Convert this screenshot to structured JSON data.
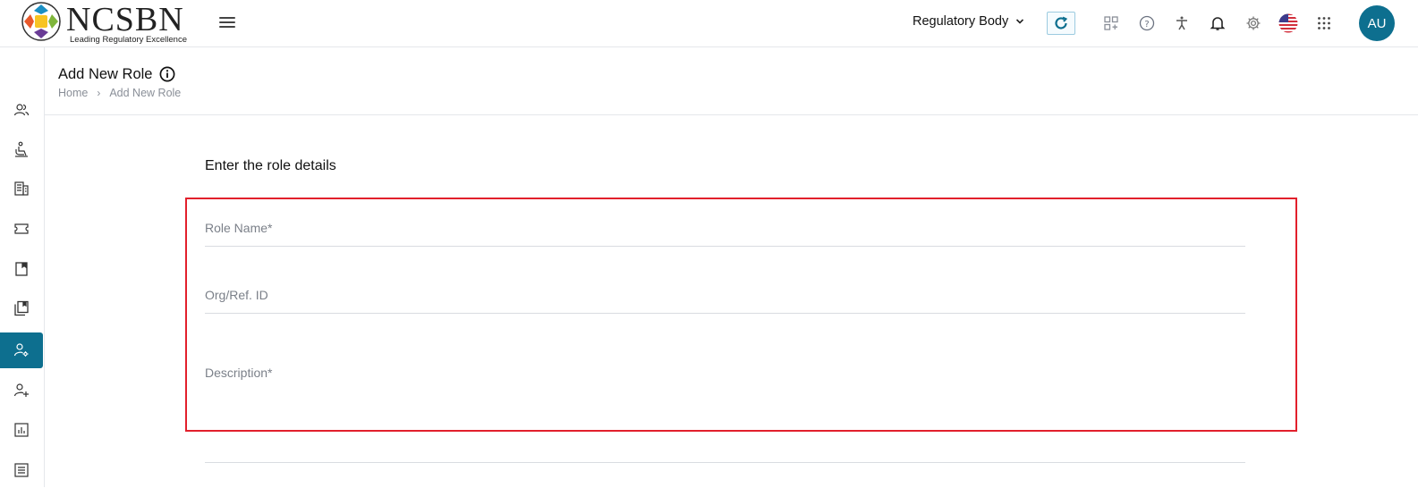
{
  "header": {
    "logo_name": "NCSBN",
    "logo_tagline": "Leading Regulatory Excellence",
    "org_selector": "Regulatory Body",
    "avatar_initials": "AU",
    "accent_color": "#0d6f8f"
  },
  "sidebar": {
    "items": [
      {
        "icon": "users-icon",
        "active": false
      },
      {
        "icon": "candidate-seat-icon",
        "active": false
      },
      {
        "icon": "building-icon",
        "active": false
      },
      {
        "icon": "ticket-icon",
        "active": false
      },
      {
        "icon": "bookmark-icon",
        "active": false
      },
      {
        "icon": "library-icon",
        "active": false
      },
      {
        "icon": "user-settings-icon",
        "active": true
      },
      {
        "icon": "add-user-icon",
        "active": false
      },
      {
        "icon": "report-chart-icon",
        "active": false
      },
      {
        "icon": "list-icon",
        "active": false
      }
    ]
  },
  "page": {
    "title": "Add New Role",
    "breadcrumb": [
      "Home",
      "Add New Role"
    ],
    "breadcrumb_sep": "›"
  },
  "form": {
    "section_title": "Enter the role details",
    "role_name_placeholder": "Role Name*",
    "org_ref_placeholder": "Org/Ref. ID",
    "description_placeholder": "Description*",
    "highlight_color": "#e2202c"
  }
}
